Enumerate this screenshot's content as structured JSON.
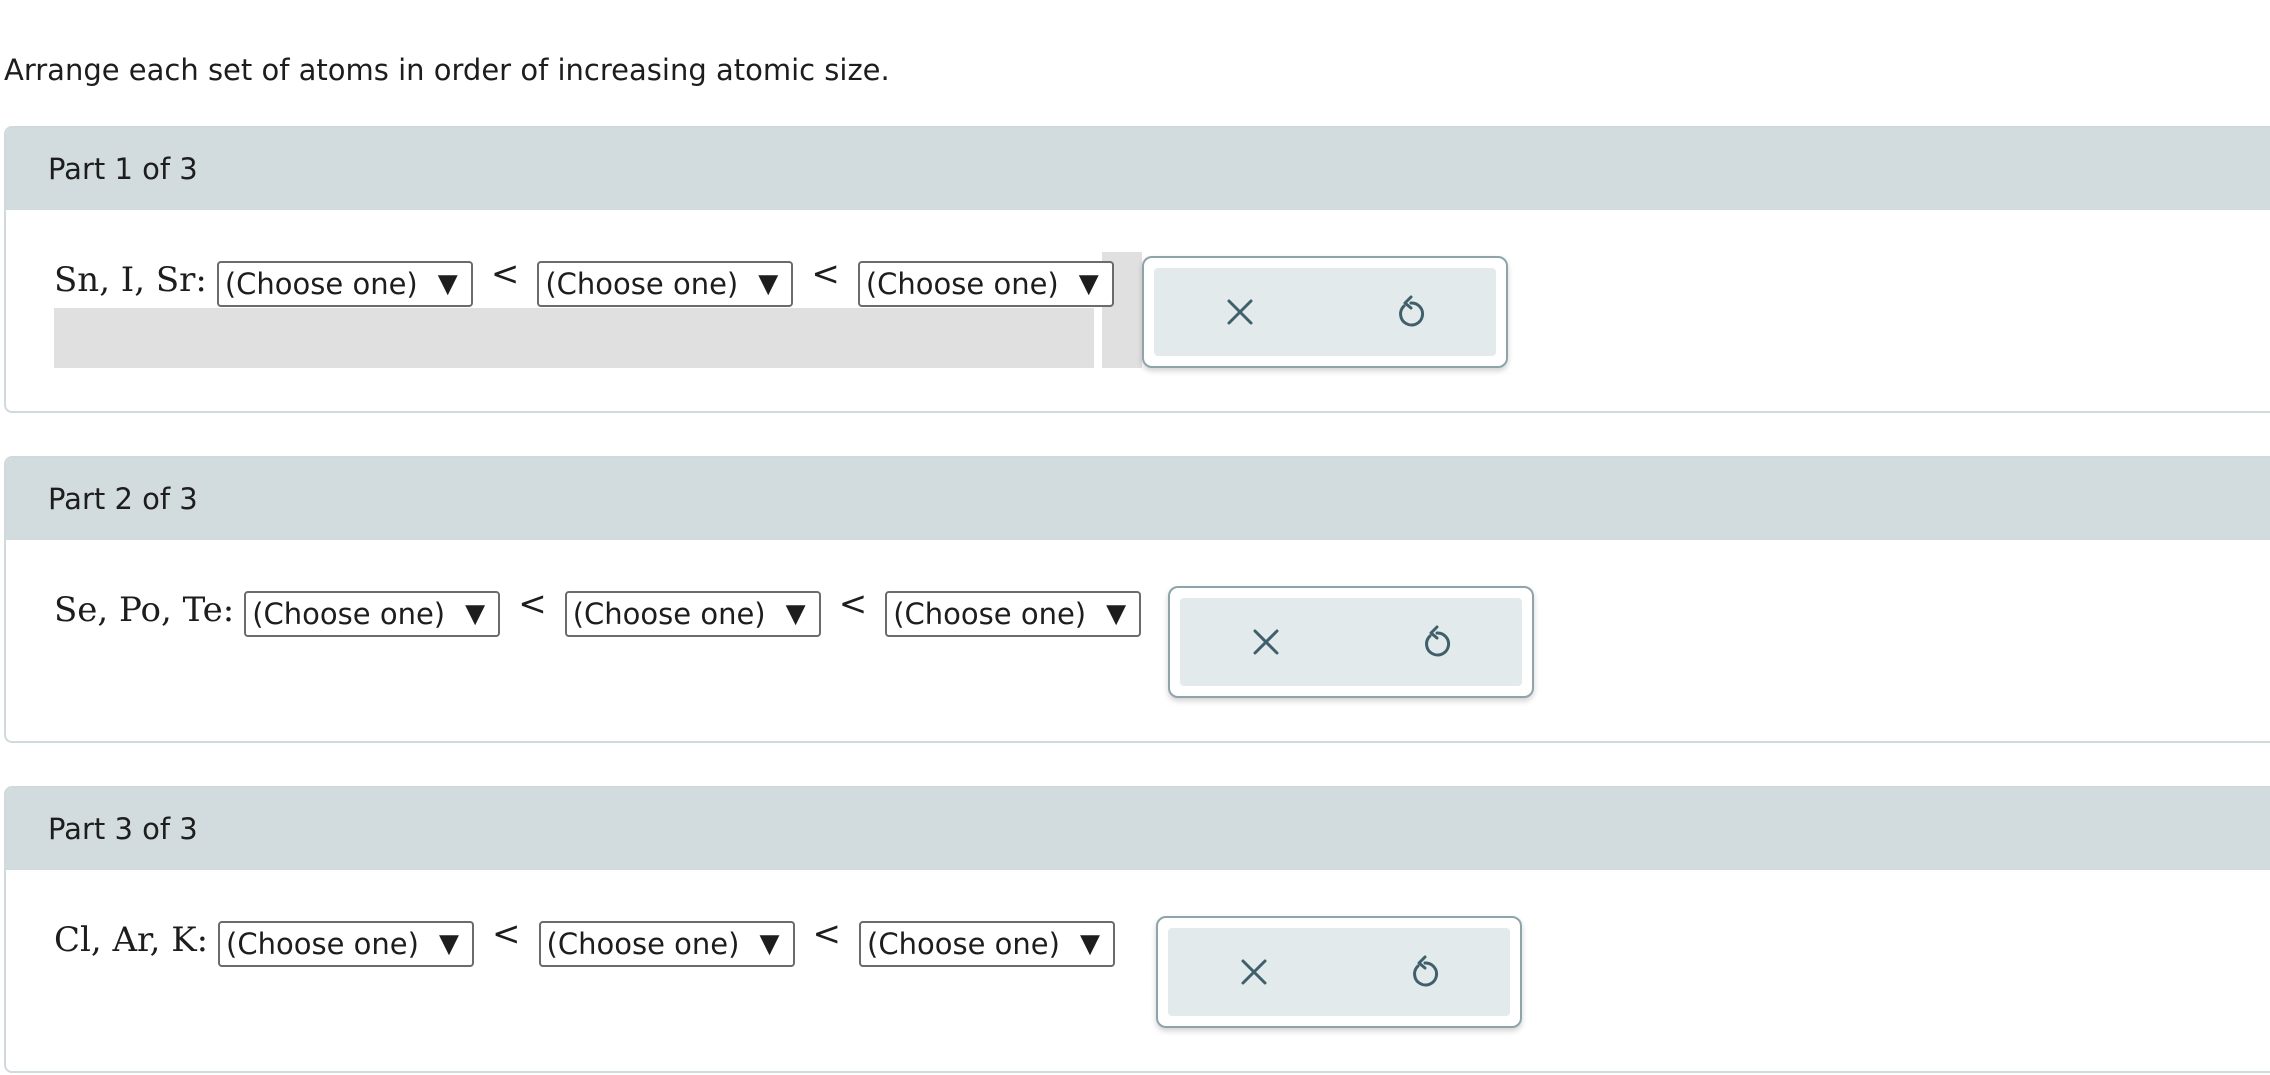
{
  "instruction": "Arrange each set of atoms in order of increasing atomic size.",
  "separator": "<",
  "select_arrow": "▼",
  "colors": {
    "header_bg": "#d2dcdf",
    "action_icon": "#3f5f6b",
    "action_bg": "#e3eaec"
  },
  "parts": [
    {
      "title": "Part 1 of 3",
      "atoms": "Sn, I, Sr:",
      "selects": [
        "(Choose one)",
        "(Choose one)",
        "(Choose one)"
      ],
      "actions": {
        "clear_icon": "x-icon",
        "reset_icon": "undo-icon"
      }
    },
    {
      "title": "Part 2 of 3",
      "atoms": "Se, Po, Te:",
      "selects": [
        "(Choose one)",
        "(Choose one)",
        "(Choose one)"
      ],
      "actions": {
        "clear_icon": "x-icon",
        "reset_icon": "undo-icon"
      }
    },
    {
      "title": "Part 3 of 3",
      "atoms": "Cl, Ar, K:",
      "selects": [
        "(Choose one)",
        "(Choose one)",
        "(Choose one)"
      ],
      "actions": {
        "clear_icon": "x-icon",
        "reset_icon": "undo-icon"
      }
    }
  ]
}
